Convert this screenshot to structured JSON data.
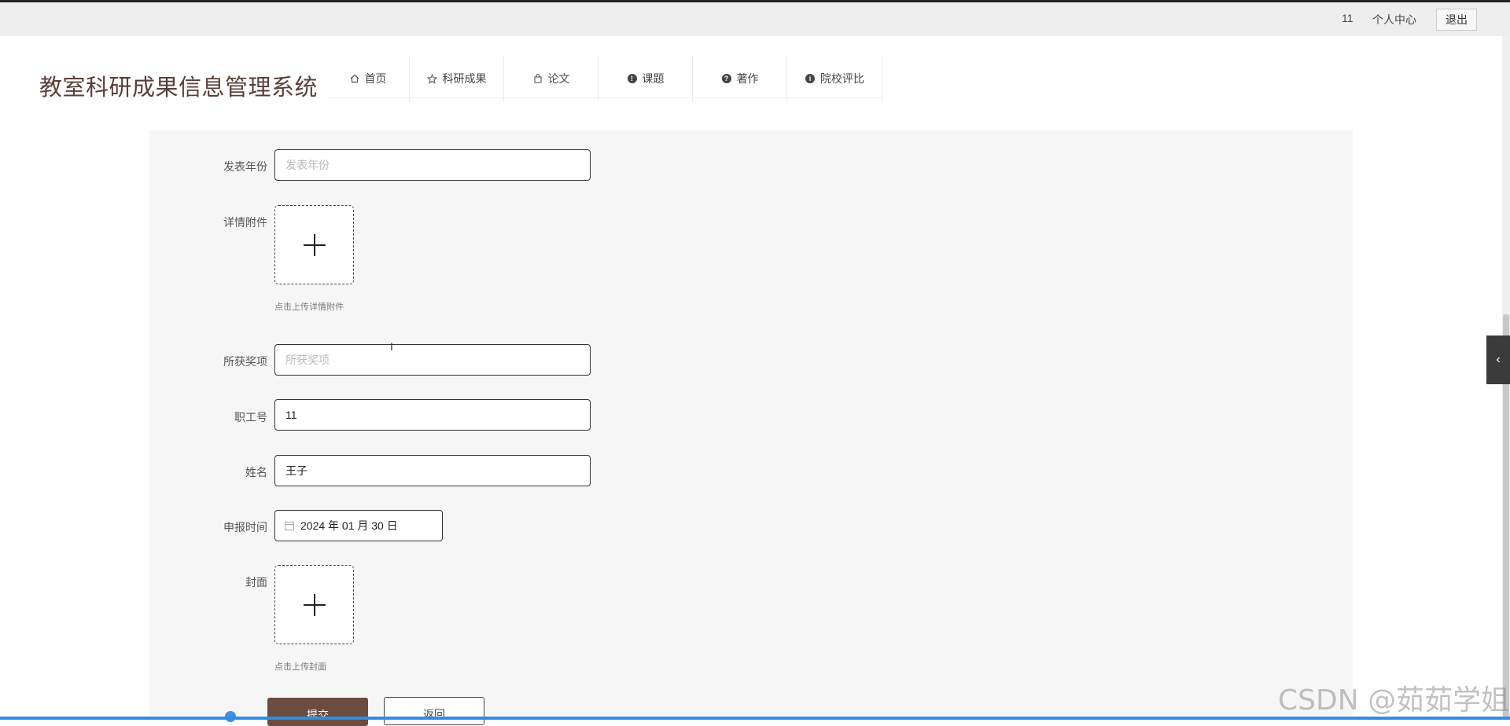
{
  "topbar": {
    "user_id": "11",
    "personal_center": "个人中心",
    "logout": "退出"
  },
  "site_title": "教室科研成果信息管理系统",
  "nav": [
    {
      "label": "首页",
      "icon": "home-icon"
    },
    {
      "label": "科研成果",
      "icon": "star-icon"
    },
    {
      "label": "论文",
      "icon": "bag-icon"
    },
    {
      "label": "课题",
      "icon": "exclamation-icon"
    },
    {
      "label": "著作",
      "icon": "question-icon"
    },
    {
      "label": "院校评比",
      "icon": "info-icon"
    }
  ],
  "form": {
    "publish_year": {
      "label": "发表年份",
      "placeholder": "发表年份"
    },
    "detail_attachment": {
      "label": "详情附件",
      "hint": "点击上传详情附件"
    },
    "award": {
      "label": "所获奖项",
      "placeholder": "所获奖项"
    },
    "staff_no": {
      "label": "职工号",
      "value": "11"
    },
    "name": {
      "label": "姓名",
      "value": "王子"
    },
    "apply_time": {
      "label": "申报时间",
      "value": "2024 年 01 月 30 日"
    },
    "cover": {
      "label": "封面",
      "hint": "点击上传封面"
    }
  },
  "buttons": {
    "submit": "提交",
    "back": "返回"
  },
  "watermark": "CSDN @茹茹学姐",
  "colors": {
    "accent": "#6b4c40",
    "title": "#5a3f38"
  }
}
